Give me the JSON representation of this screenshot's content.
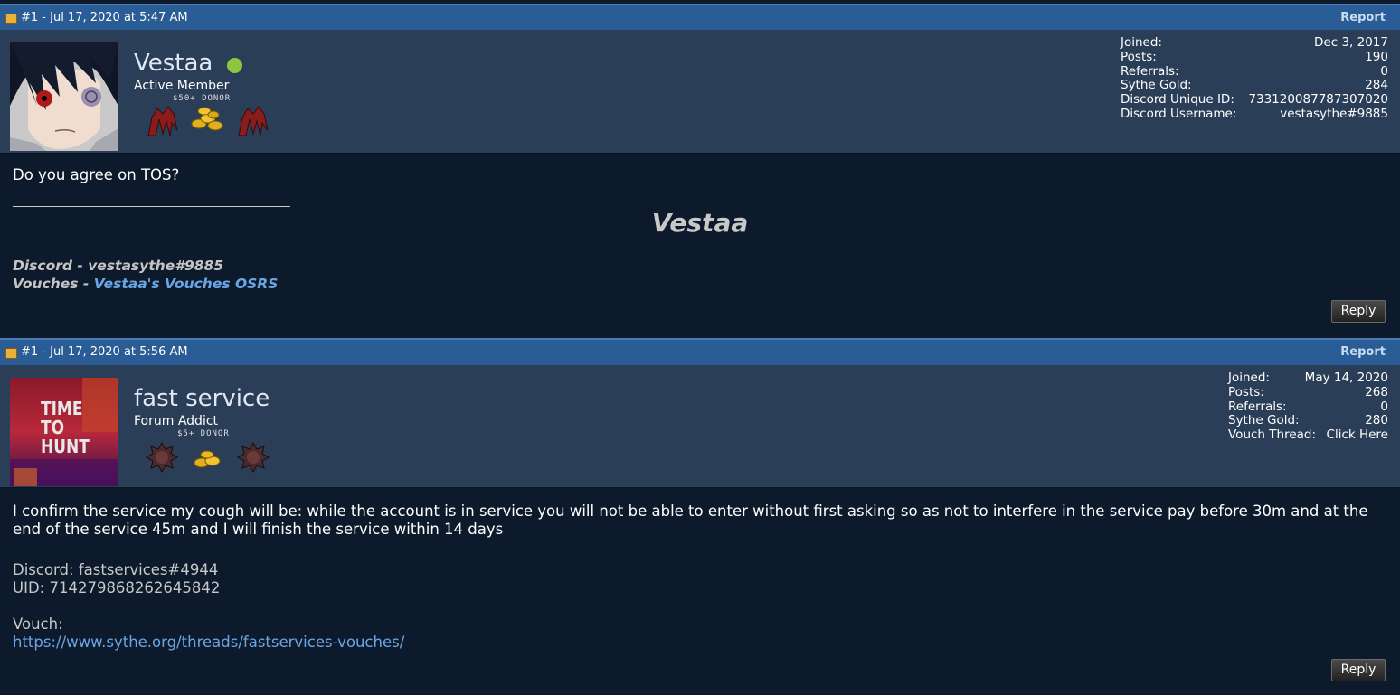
{
  "posts": [
    {
      "header": {
        "date": "#1 - Jul 17, 2020 at 5:47 AM",
        "report_label": "Report"
      },
      "user": {
        "name": "Vestaa",
        "title": "Active Member",
        "donor_label": "$50+ DONOR",
        "online": true
      },
      "stats": [
        {
          "label": "Joined:",
          "value": "Dec 3, 2017"
        },
        {
          "label": "Posts:",
          "value": "190"
        },
        {
          "label": "Referrals:",
          "value": "0"
        },
        {
          "label": "Sythe Gold:",
          "value": "284"
        },
        {
          "label": "Discord Unique ID:",
          "value": "733120087787307020"
        },
        {
          "label": "Discord Username:",
          "value": "vestasythe#9885"
        }
      ],
      "message": "Do you agree on TOS?",
      "signature": {
        "name": "Vestaa",
        "discord_prefix": "Discord - vestasythe#9885",
        "vouches_prefix": "Vouches - ",
        "vouches_link": "Vestaa's Vouches OSRS"
      },
      "reply_label": "Reply"
    },
    {
      "header": {
        "date": "#1 - Jul 17, 2020 at 5:56 AM",
        "report_label": "Report"
      },
      "user": {
        "name": "fast service",
        "title": "Forum Addict",
        "donor_label": "$5+ DONOR",
        "avatar_text": [
          "TIME",
          "TO",
          "HUNT"
        ]
      },
      "stats": [
        {
          "label": "Joined:",
          "value": "May 14, 2020"
        },
        {
          "label": "Posts:",
          "value": "268"
        },
        {
          "label": "Referrals:",
          "value": "0"
        },
        {
          "label": "Sythe Gold:",
          "value": "280"
        },
        {
          "label": "Vouch Thread:",
          "value": "Click Here"
        }
      ],
      "message": "I confirm the service my cough will be: while the account is in service you will not be able to enter without first asking so as not to interfere in the service pay before 30m and at the end of the service 45m and I will finish the service within 14 days",
      "signature": {
        "discord": "Discord: fastservices#4944",
        "uid": "UID: 714279868262645842",
        "vouch_label": "Vouch:",
        "vouch_link": "https://www.sythe.org/threads/fastservices-vouches/"
      },
      "reply_label": "Reply"
    }
  ],
  "colors": {
    "header_bar": "#2a5c96",
    "user_panel": "#2b3e57",
    "body_bg": "#0d1a2b",
    "online": "#8bc63f",
    "link": "#6aa6e6"
  }
}
